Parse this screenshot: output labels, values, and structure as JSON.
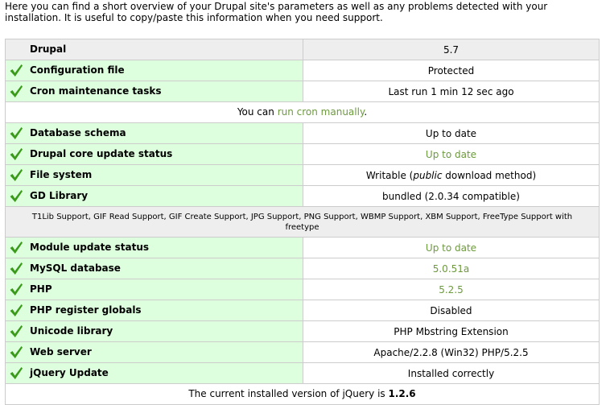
{
  "intro": "Here you can find a short overview of your Drupal site's parameters as well as any problems detected with your installation. It is useful to copy/paste this information when you need support.",
  "rows": {
    "drupal": {
      "title": "Drupal",
      "value": "5.7"
    },
    "config": {
      "title": "Configuration file",
      "value": "Protected"
    },
    "cron": {
      "title": "Cron maintenance tasks",
      "value": "Last run 1 min 12 sec ago",
      "desc_prefix": "You can ",
      "desc_link": "run cron manually",
      "desc_suffix": "."
    },
    "schema": {
      "title": "Database schema",
      "value": "Up to date"
    },
    "core_update": {
      "title": "Drupal core update status",
      "value": "Up to date"
    },
    "filesystem": {
      "title": "File system",
      "value_prefix": "Writable (",
      "value_em": "public",
      "value_suffix": " download method)"
    },
    "gd": {
      "title": "GD Library",
      "value": "bundled (2.0.34 compatible)",
      "desc": "T1Lib Support, GIF Read Support, GIF Create Support, JPG Support, PNG Support, WBMP Support, XBM Support, FreeType Support with freetype"
    },
    "module_update": {
      "title": "Module update status",
      "value": "Up to date"
    },
    "mysql": {
      "title": "MySQL database",
      "value": "5.0.51a"
    },
    "php": {
      "title": "PHP",
      "value": "5.2.5"
    },
    "register_globals": {
      "title": "PHP register globals",
      "value": "Disabled"
    },
    "unicode": {
      "title": "Unicode library",
      "value": "PHP Mbstring Extension"
    },
    "webserver": {
      "title": "Web server",
      "value": "Apache/2.2.8 (Win32) PHP/5.2.5"
    },
    "jquery": {
      "title": "jQuery Update",
      "value": "Installed correctly",
      "desc_prefix": "The current installed version of jQuery is ",
      "desc_version": "1.2.6"
    }
  },
  "colors": {
    "ok_background": "#ddffdd",
    "neutral_background": "#eeeeee",
    "link": "#6d9a3e",
    "check": "#3a9a1a"
  },
  "icons": {
    "status_ok": "check-icon"
  }
}
